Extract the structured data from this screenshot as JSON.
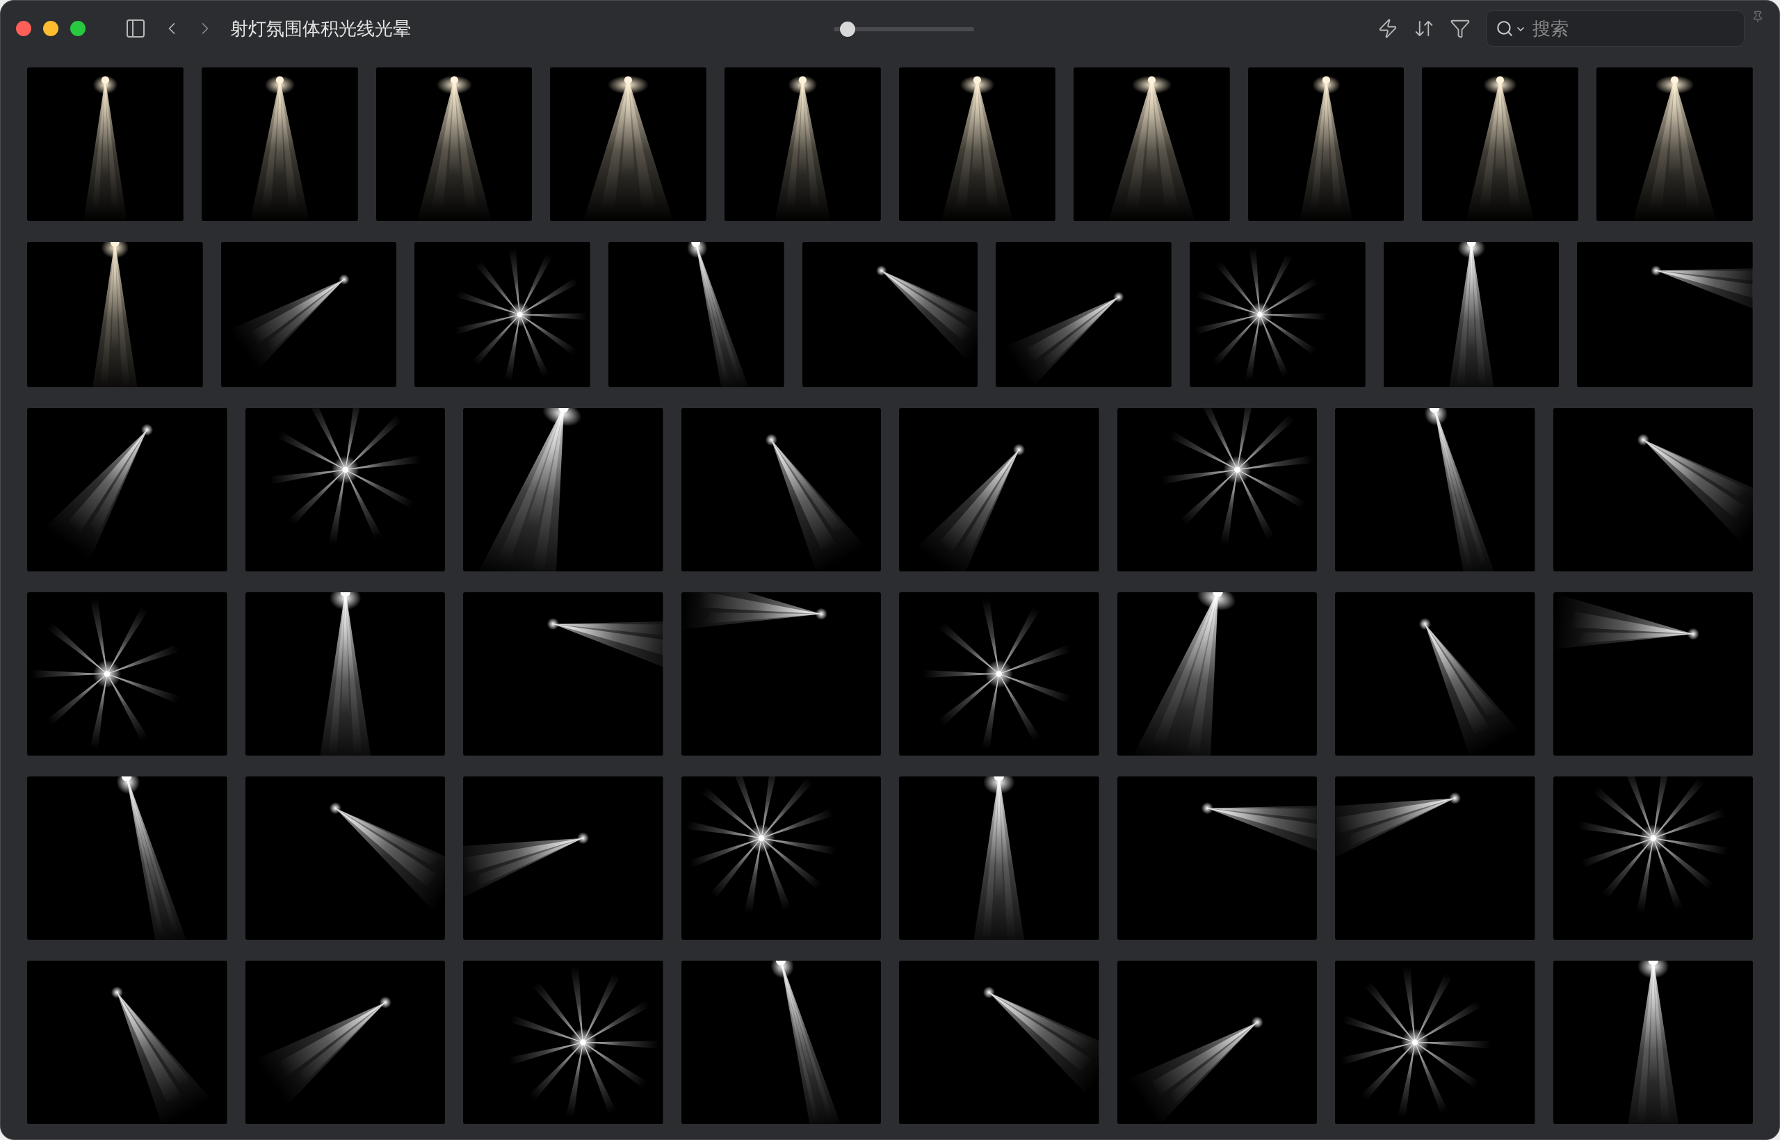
{
  "window": {
    "title": "射灯氛围体积光线光晕"
  },
  "zoom_slider": {
    "level": 0.1
  },
  "search": {
    "placeholder": "搜索"
  }
}
